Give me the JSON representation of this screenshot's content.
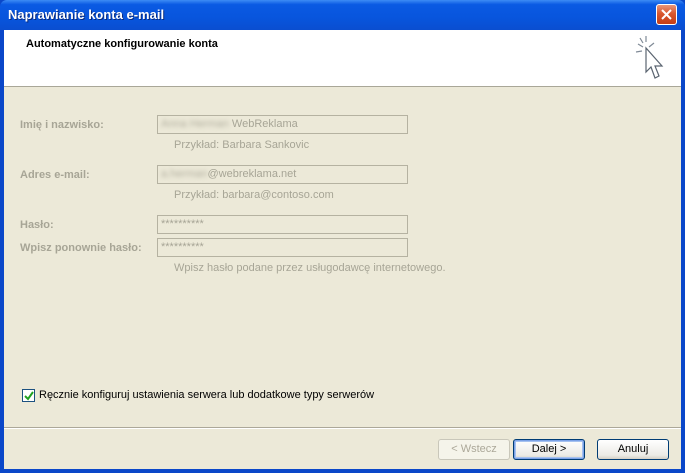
{
  "window": {
    "title": "Naprawianie konta e-mail"
  },
  "header": {
    "title": "Automatyczne konfigurowanie konta"
  },
  "form": {
    "name": {
      "label": "Imię i nazwisko:",
      "value_blurred": "Anna Herman",
      "value": " WebReklama",
      "hint": "Przykład: Barbara Sankovic"
    },
    "email": {
      "label": "Adres e-mail:",
      "value_blurred": "a.herman",
      "value": "@webreklama.net",
      "hint": "Przykład: barbara@contoso.com"
    },
    "password": {
      "label": "Hasło:",
      "value": "**********"
    },
    "password_repeat": {
      "label": "Wpisz ponownie hasło:",
      "value": "**********",
      "hint": "Wpisz hasło podane przez usługodawcę internetowego."
    }
  },
  "manual_config": {
    "label": "Ręcznie konfiguruj ustawienia serwera lub dodatkowe typy serwerów",
    "checked": true
  },
  "buttons": {
    "back": "< Wstecz",
    "next": "Dalej >",
    "cancel": "Anuluj"
  }
}
